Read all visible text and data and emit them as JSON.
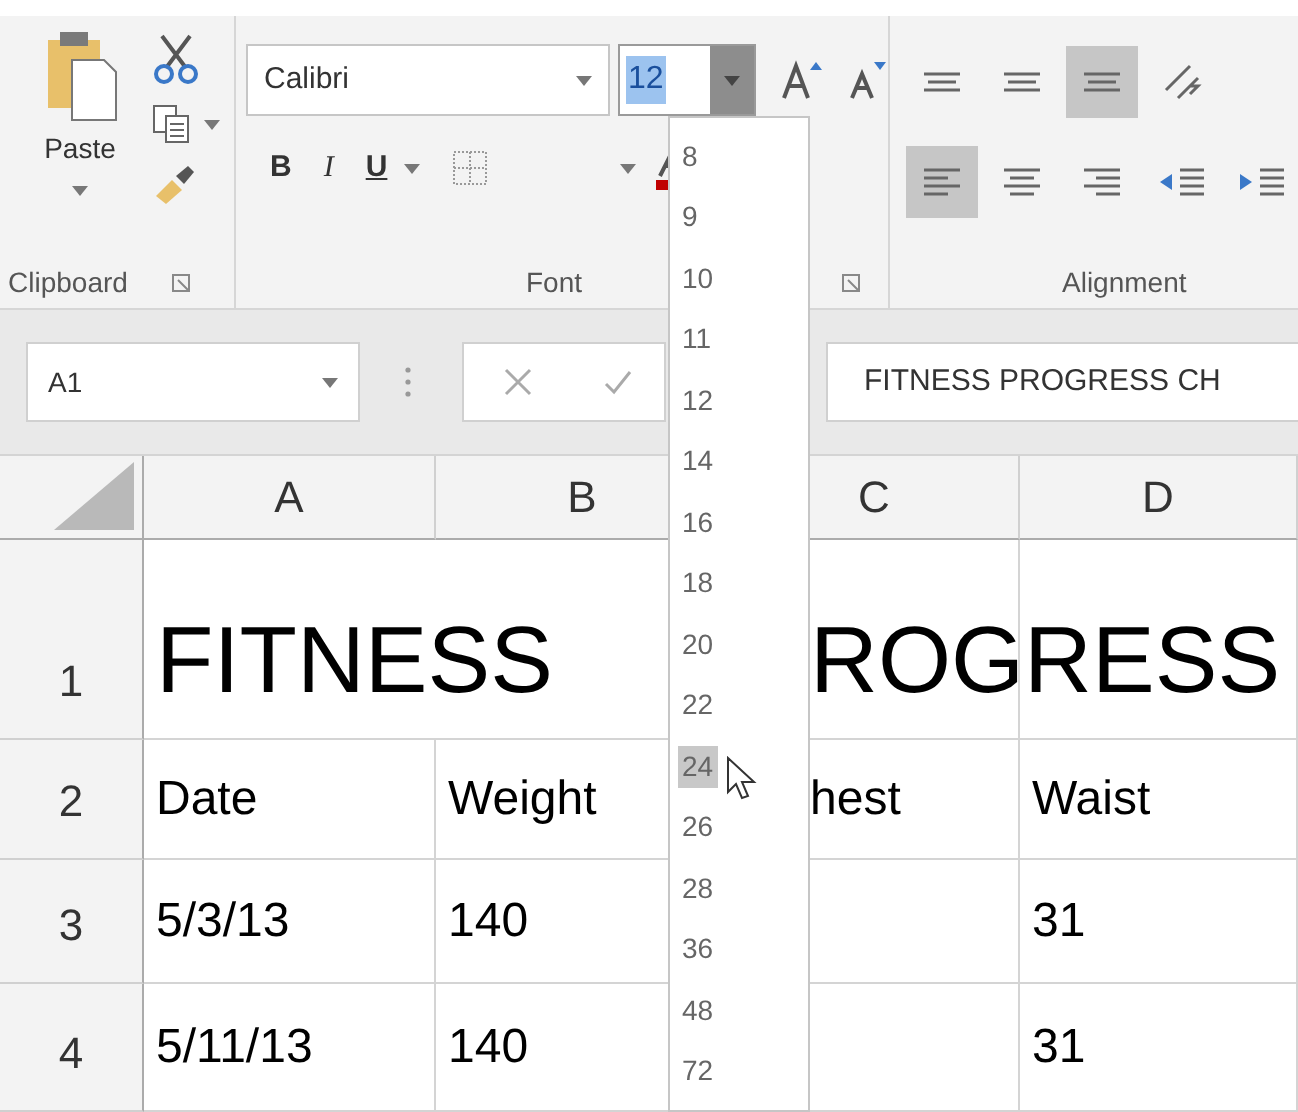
{
  "ribbon": {
    "clipboard": {
      "paste_label": "Paste",
      "group_label": "Clipboard"
    },
    "font": {
      "font_name": "Calibri",
      "font_size": "12",
      "format_buttons": [
        "B",
        "I",
        "U"
      ],
      "group_label": "Font"
    },
    "alignment": {
      "top_buttons": [
        {
          "kind": "top",
          "selected": false
        },
        {
          "kind": "middle",
          "selected": false
        },
        {
          "kind": "bottom",
          "selected": true
        },
        {
          "kind": "orientation",
          "selected": false
        }
      ],
      "bottom_buttons": [
        {
          "kind": "left",
          "selected": true
        },
        {
          "kind": "center",
          "selected": false
        },
        {
          "kind": "right",
          "selected": false
        },
        {
          "kind": "outdent",
          "selected": false
        },
        {
          "kind": "indent",
          "selected": false
        }
      ],
      "group_label": "Alignment"
    }
  },
  "font_size_list": [
    {
      "label": "8",
      "highlighted": false
    },
    {
      "label": "9",
      "highlighted": false
    },
    {
      "label": "10",
      "highlighted": false
    },
    {
      "label": "11",
      "highlighted": false
    },
    {
      "label": "12",
      "highlighted": false
    },
    {
      "label": "14",
      "highlighted": false
    },
    {
      "label": "16",
      "highlighted": false
    },
    {
      "label": "18",
      "highlighted": false
    },
    {
      "label": "20",
      "highlighted": false
    },
    {
      "label": "22",
      "highlighted": false
    },
    {
      "label": "24",
      "highlighted": true
    },
    {
      "label": "26",
      "highlighted": false
    },
    {
      "label": "28",
      "highlighted": false
    },
    {
      "label": "36",
      "highlighted": false
    },
    {
      "label": "48",
      "highlighted": false
    },
    {
      "label": "72",
      "highlighted": false
    }
  ],
  "formula_bar": {
    "name_box": "A1",
    "formula": "FITNESS PROGRESS CH"
  },
  "columns": [
    "A",
    "B",
    "C",
    "D"
  ],
  "rows": [
    {
      "header": "1",
      "column_a": "FITNESS",
      "column_c": "ROGRESS"
    },
    {
      "header": "2",
      "column_a": "Date",
      "column_b": "Weight",
      "column_c": "hest",
      "column_d": "Waist"
    },
    {
      "header": "3",
      "column_a": "5/3/13",
      "column_b": "140",
      "column_d": "31"
    },
    {
      "header": "4",
      "column_a": "5/11/13",
      "column_b": "140",
      "column_d": "31"
    }
  ]
}
